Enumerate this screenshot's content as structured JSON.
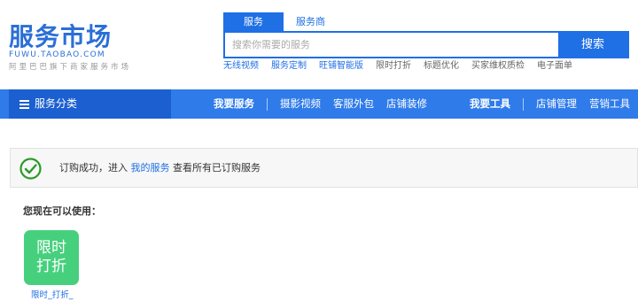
{
  "logo": {
    "title": "服务市场",
    "domain": "FUWU.TAOBAO.COM",
    "slogan": "阿里巴巴旗下商家服务市场"
  },
  "search": {
    "tabs": [
      "服务",
      "服务商"
    ],
    "placeholder": "搜索你需要的服务",
    "button_label": "搜索"
  },
  "hot_links": [
    "无线视频",
    "服务定制",
    "旺铺智能版",
    "限时打折",
    "标题优化",
    "买家维权质检",
    "电子面单"
  ],
  "nav": {
    "category_label": "服务分类",
    "items": [
      "我要服务",
      "摄影视频",
      "客服外包",
      "店铺装修",
      "我要工具",
      "店铺管理",
      "营销工具"
    ]
  },
  "notice": {
    "prefix": "订购成功，进入",
    "link": "我的服务",
    "suffix": "查看所有已订购服务",
    "color_success": "#2a9a2a"
  },
  "available": {
    "label": "您现在可以使用：",
    "tool_card_text": "限时\n打折",
    "tool_caption": "限时_打折_",
    "card_color": "#46d07d"
  },
  "colors": {
    "brand": "#2b6fd6",
    "nav_bg": "#2f7bea",
    "nav_category_bg": "#1b5fd0"
  }
}
